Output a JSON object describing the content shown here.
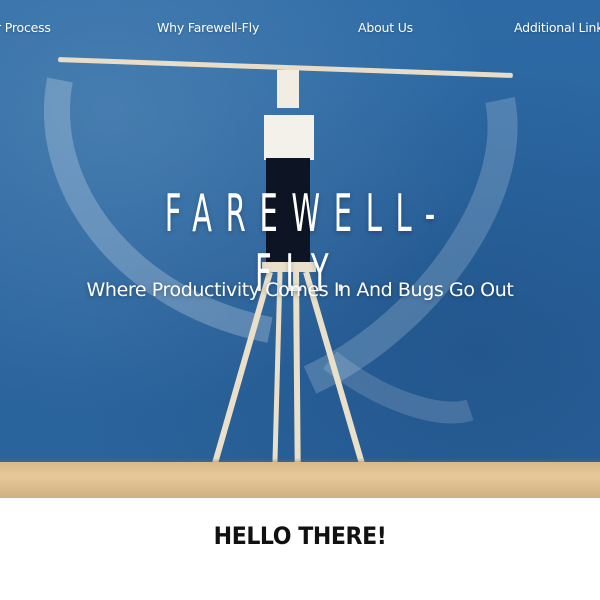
{
  "nav": {
    "items": [
      {
        "label": "r Process"
      },
      {
        "label": "Why Farewell-Fly"
      },
      {
        "label": "About Us"
      },
      {
        "label": "Additional Links"
      }
    ]
  },
  "hero": {
    "title": "FAREWELL-FLY.",
    "subtitle": "Where Productivity Comes In And Bugs Go Out",
    "colors": {
      "wall": "#2b66a0",
      "floor": "#e0c293",
      "text": "#ffffff"
    }
  },
  "intro": {
    "heading": "HELLO THERE!",
    "body": ""
  }
}
